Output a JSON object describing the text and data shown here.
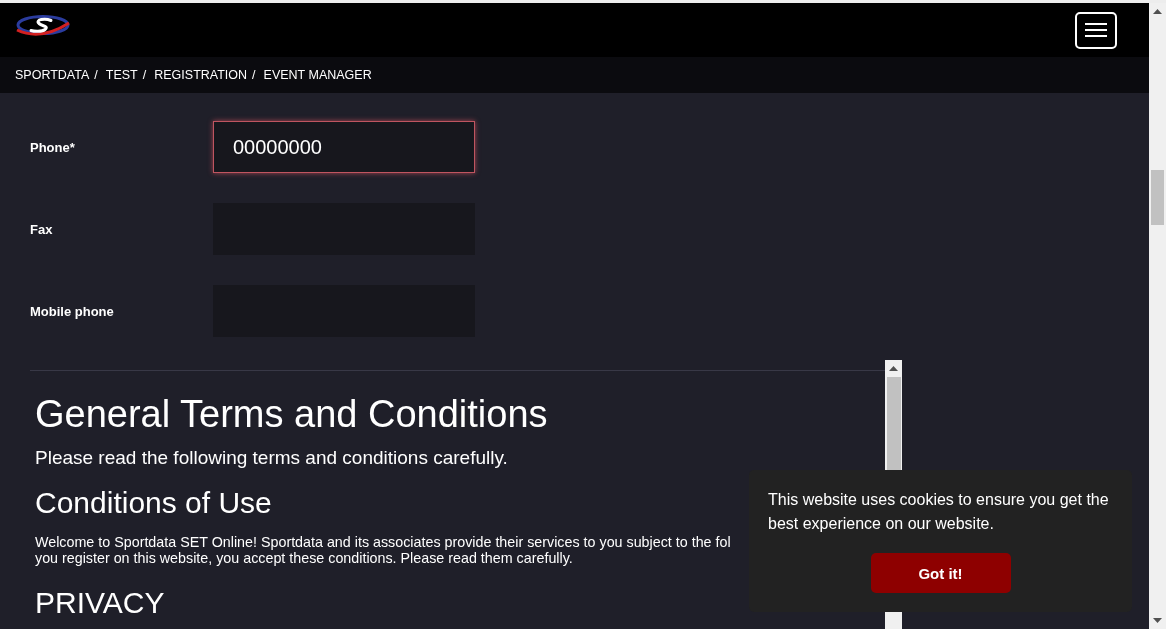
{
  "breadcrumb": [
    {
      "label": "SPORTDATA",
      "separator": "/"
    },
    {
      "label": "TEST",
      "separator": "/"
    },
    {
      "label": "REGISTRATION",
      "separator": "/"
    },
    {
      "label": "EVENT MANAGER"
    }
  ],
  "form": {
    "rows": [
      {
        "label": "Phone*",
        "kind": "input",
        "value": "00000000",
        "focused": true
      },
      {
        "label": "Fax",
        "kind": "input",
        "focused": false
      },
      {
        "label": "Mobile phone",
        "kind": "input",
        "focused": false
      }
    ]
  },
  "terms": {
    "title": "General Terms and Conditions",
    "intro": "Please read the following terms and conditions carefully.",
    "sections": [
      {
        "heading": "Conditions of Use",
        "lines": [
          "Welcome to Sportdata SET Online! Sportdata and its associates provide their services to you subject to the fol",
          "you register on this website, you accept these conditions. Please read them carefully."
        ]
      },
      {
        "heading": "PRIVACY"
      }
    ]
  },
  "cookie_banner": {
    "message": "This website uses cookies to ensure you get the best experience on our website.",
    "button": "Got it!"
  }
}
